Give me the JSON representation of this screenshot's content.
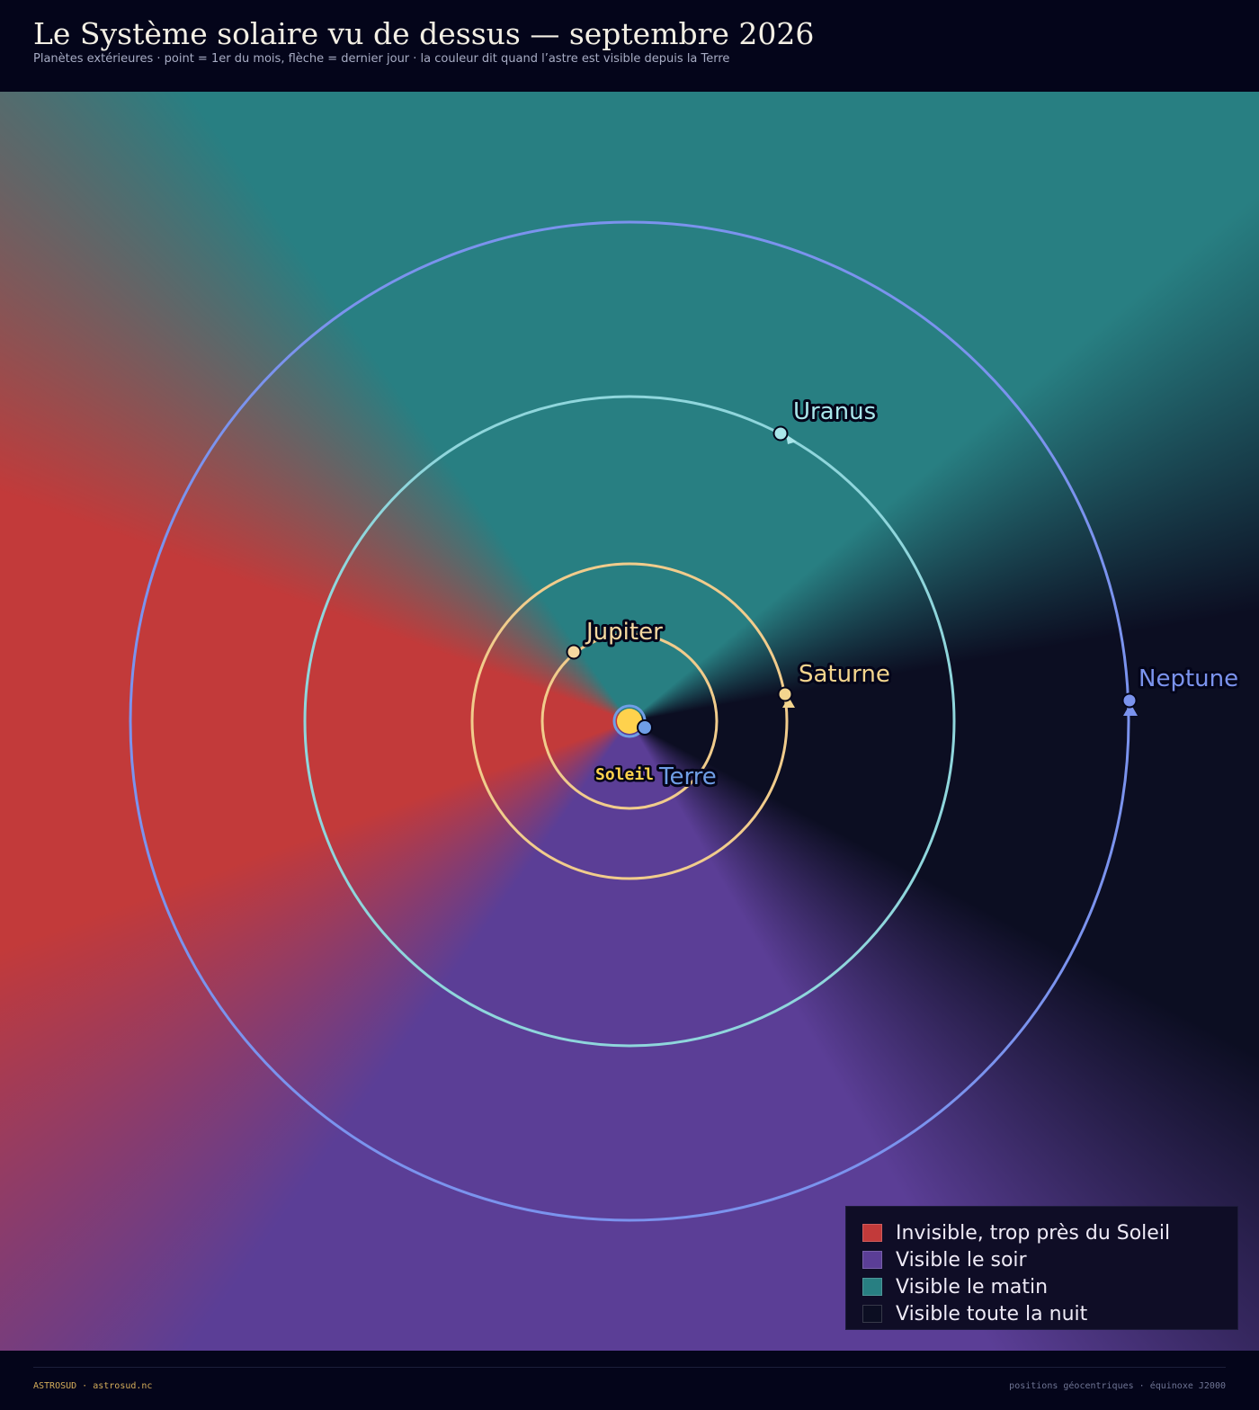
{
  "header": {
    "title": "Le Système solaire vu de dessus — septembre 2026",
    "subtitle": "Planètes extérieures · point = 1er du mois, flèche = dernier jour · la couleur dit quand l’astre est visible depuis la Terre"
  },
  "zones": {
    "colors": {
      "invisible": "#c23a3a",
      "soir": "#5b3e96",
      "matin": "#287f82",
      "nuit": "#0c0e22"
    }
  },
  "bodies": {
    "sun": {
      "label": "Soleil",
      "color": "#ffd24d"
    },
    "earth": {
      "label": "Terre",
      "color": "#6f9ee6"
    },
    "planets": [
      {
        "id": "jupiter",
        "label": "Jupiter",
        "color": "#f5d8a0",
        "orbit_color": "#f1cc8c"
      },
      {
        "id": "saturne",
        "label": "Saturne",
        "color": "#f3d58e",
        "orbit_color": "#f1cc8c"
      },
      {
        "id": "uranus",
        "label": "Uranus",
        "color": "#a9e6ea",
        "orbit_color": "#8fd6dc"
      },
      {
        "id": "neptune",
        "label": "Neptune",
        "color": "#7b93ee",
        "orbit_color": "#7b93ee"
      }
    ]
  },
  "legend": {
    "items": [
      {
        "label": "Invisible, trop près du Soleil",
        "color": "#c23a3a"
      },
      {
        "label": "Visible le soir",
        "color": "#5b3e96"
      },
      {
        "label": "Visible le matin",
        "color": "#287f82"
      },
      {
        "label": "Visible toute la nuit",
        "color": "#0c0e22"
      }
    ]
  },
  "footer": {
    "left": "ASTROSUD · astrosud.nc",
    "right": "positions géocentriques · équinoxe J2000"
  }
}
